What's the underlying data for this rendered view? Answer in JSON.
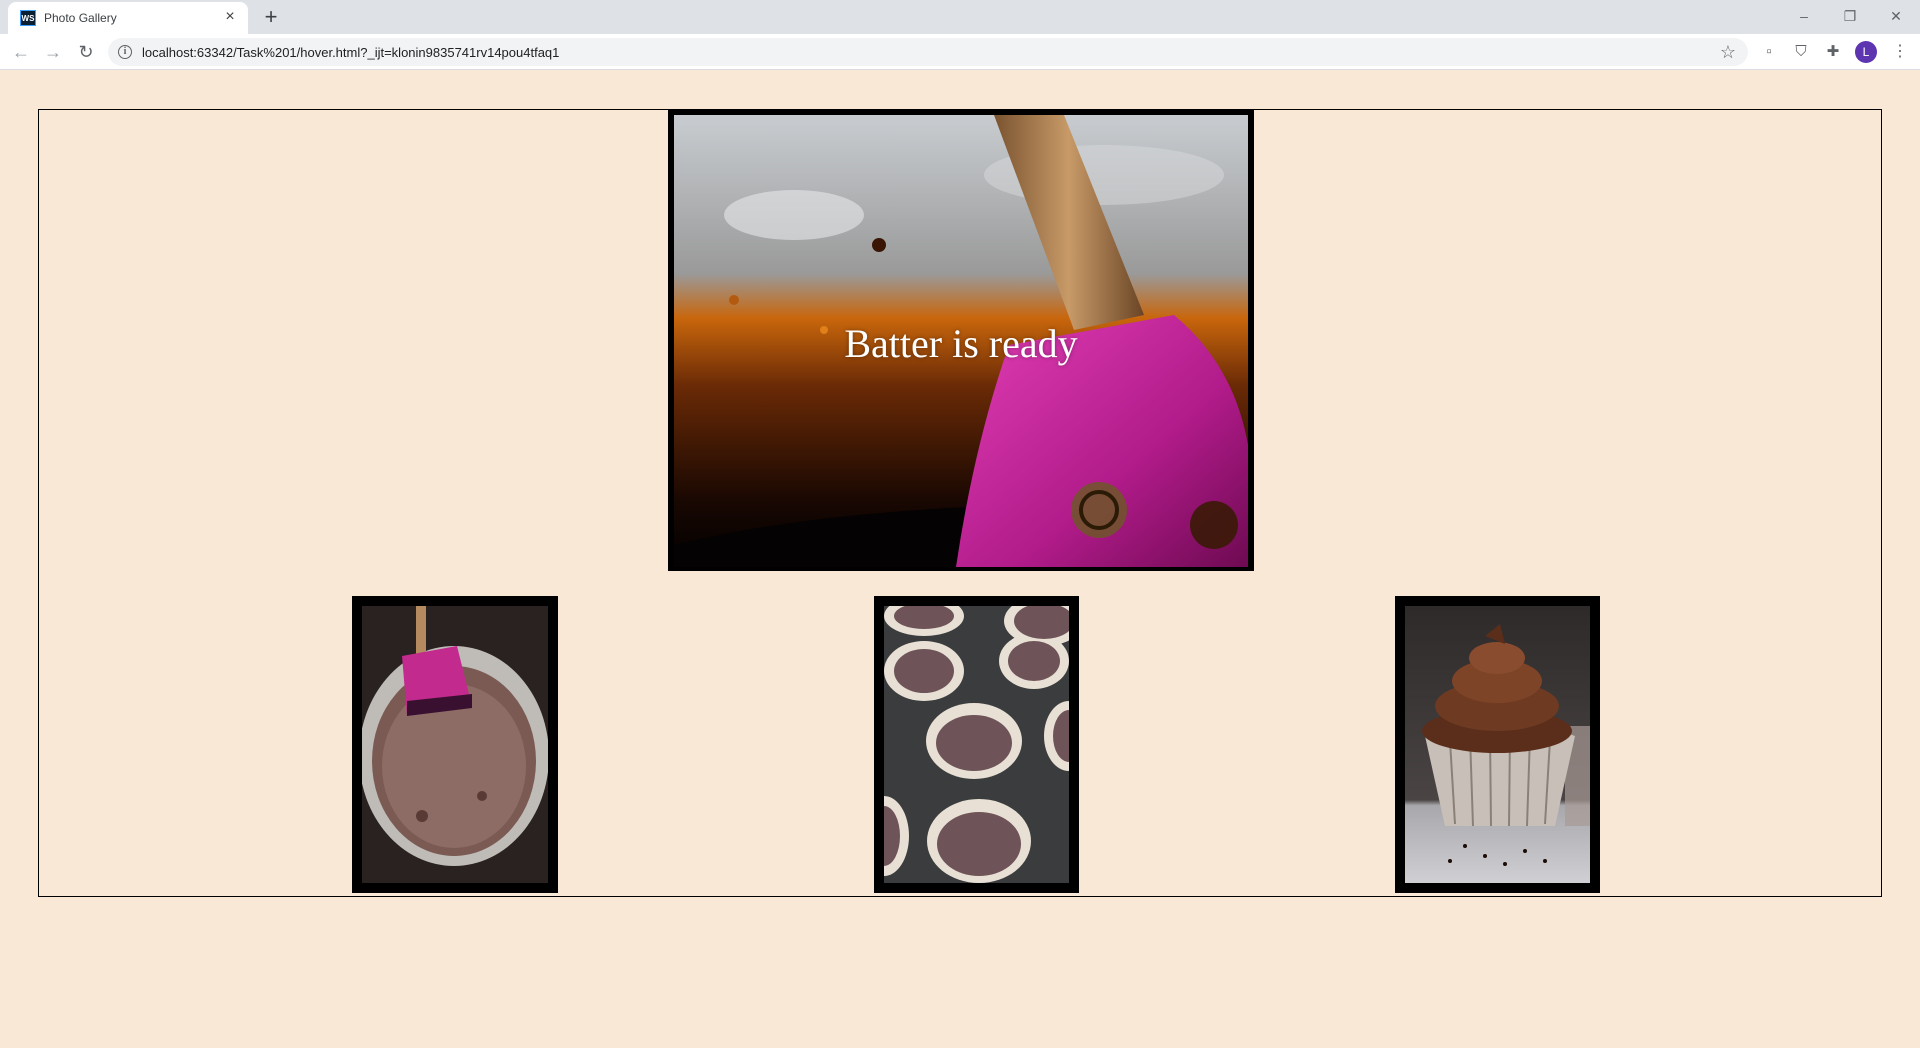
{
  "browser": {
    "tab_title": "Photo Gallery",
    "favicon_text": "WS",
    "url": "localhost:63342/Task%201/hover.html?_ijt=klonin9835741rv14pou4tfaq1",
    "profile_initial": "L"
  },
  "gallery": {
    "main_caption": "Batter is ready",
    "thumbnails": [
      {
        "subject": "chocolate batter in bowl with pink spatula"
      },
      {
        "subject": "batter in cupcake liners"
      },
      {
        "subject": "frosted chocolate cupcake"
      }
    ]
  },
  "colors": {
    "page_background": "#f9e8d6",
    "frame": "#000000"
  }
}
